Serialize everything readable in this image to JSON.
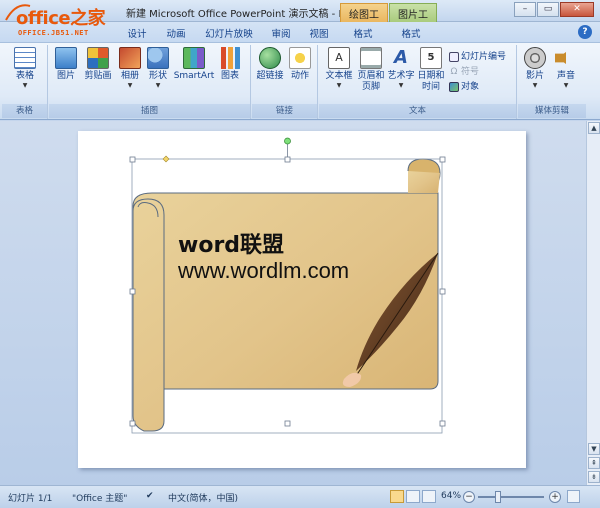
{
  "logo": {
    "brand": "office之家",
    "sub": "OFFICE.JB51.NET"
  },
  "window": {
    "title": "新建 Microsoft Office PowerPoint 演示文稿 - M...",
    "context_tab_draw": "绘图工具",
    "context_tab_picture": "图片工具"
  },
  "tabs": [
    "设计",
    "动画",
    "幻灯片放映",
    "审阅",
    "视图",
    "格式",
    "格式"
  ],
  "ribbon": {
    "table_group": {
      "label": "表格",
      "table_btn": "表格"
    },
    "illustration_group": {
      "label": "插图",
      "picture": "图片",
      "clipart": "剪贴画",
      "album": "相册",
      "shapes": "形状",
      "smartart": "SmartArt",
      "chart": "图表"
    },
    "link_group": {
      "label": "链接",
      "hyperlink": "超链接",
      "action": "动作"
    },
    "text_group": {
      "label": "文本",
      "textbox": "文本框",
      "header_footer_1": "页眉和",
      "header_footer_2": "页脚",
      "wordart": "艺术字",
      "datetime_1": "日期和",
      "datetime_2": "时间",
      "slide_number": "幻灯片编号",
      "symbol": "符号",
      "object": "对象"
    },
    "media_group": {
      "label": "媒体剪辑",
      "movie": "影片",
      "sound": "声音"
    }
  },
  "slide": {
    "heading": "word联盟",
    "url": "www.wordlm.com"
  },
  "status": {
    "slide_info": "幻灯片 1/1",
    "theme": "\"Office 主题\"",
    "language": "中文(简体，中国)",
    "zoom": "64%"
  },
  "zoom_level": 0.64,
  "colors": {
    "ribbon_bg": "#dfeaf7",
    "accent": "#15428b",
    "logo": "#e8590c"
  }
}
